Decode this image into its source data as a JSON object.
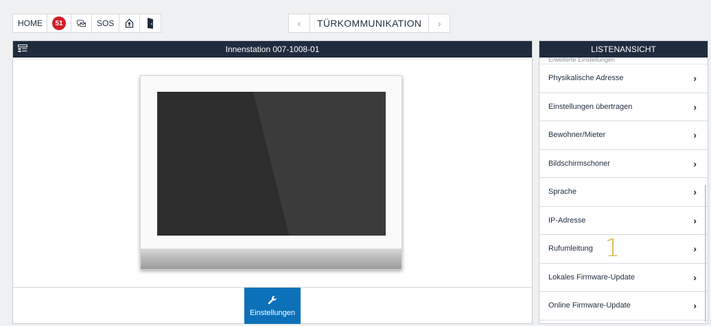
{
  "toolbar": {
    "home_label": "HOME",
    "badge_count": "51",
    "sos_label": "SOS",
    "icons": [
      "message-icon",
      "shield-house-icon",
      "door-icon"
    ]
  },
  "nav": {
    "prev_icon": "‹",
    "title": "TÜRKOMMUNIKATION",
    "next_icon": "›"
  },
  "main": {
    "header": "Innenstation 007-1008-01",
    "settings_label": "Einstellungen"
  },
  "side": {
    "header": "LISTENANSICHT",
    "section_header": "Erweiterte Einstellungen",
    "items": [
      {
        "label": "Physikalische Adresse"
      },
      {
        "label": "Einstellungen übertragen"
      },
      {
        "label": "Bewohner/Mieter"
      },
      {
        "label": "Bildschirmschoner"
      },
      {
        "label": "Sprache"
      },
      {
        "label": "IP-Adresse"
      },
      {
        "label": "Rufumleitung",
        "marker": "1"
      },
      {
        "label": "Lokales Firmware-Update"
      },
      {
        "label": "Online Firmware-Update"
      }
    ]
  },
  "colors": {
    "header_bg": "#1e2c3e",
    "accent_blue": "#0c71b9",
    "badge_red": "#d31e2b",
    "marker_gold": "#d9b64e"
  }
}
